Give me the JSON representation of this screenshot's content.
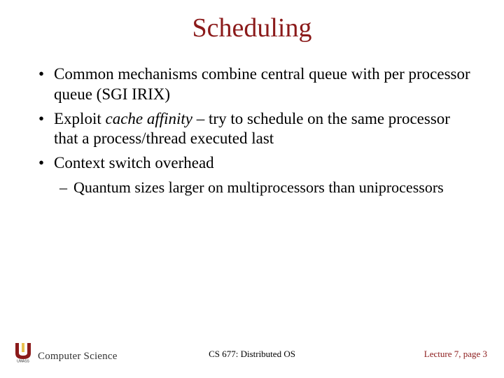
{
  "title": "Scheduling",
  "bullets": {
    "b1": "Common mechanisms combine central queue with per processor queue (SGI IRIX)",
    "b2_pre": "Exploit ",
    "b2_em": "cache affinity",
    "b2_post": " – try to schedule on the same processor that a process/thread executed last",
    "b3": "Context switch overhead",
    "b3_sub": "Quantum sizes larger on multiprocessors than uniprocessors"
  },
  "footer": {
    "dept": "Computer Science",
    "course": "CS 677: Distributed OS",
    "lecture": "Lecture 7, page 3"
  }
}
